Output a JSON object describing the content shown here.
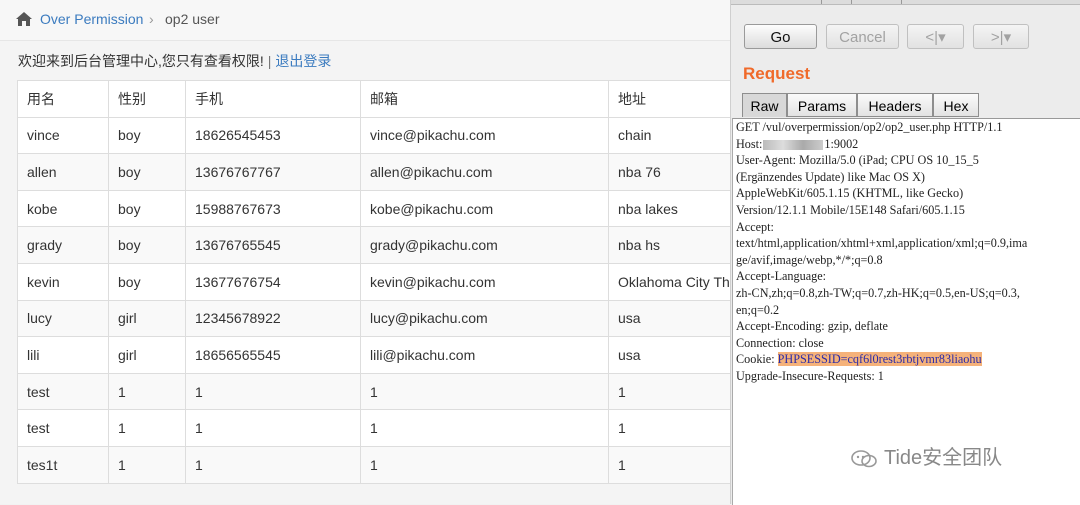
{
  "breadcrumb": {
    "root": "Over Permission",
    "current": "op2 user"
  },
  "welcome": {
    "text": "欢迎来到后台管理中心,您只有查看权限!",
    "separator": "|",
    "logout": "退出登录"
  },
  "table": {
    "headers": [
      "用名",
      "性别",
      "手机",
      "邮箱",
      "地址"
    ],
    "rows": [
      [
        "vince",
        "boy",
        "18626545453",
        "vince@pikachu.com",
        "chain"
      ],
      [
        "allen",
        "boy",
        "13676767767",
        "allen@pikachu.com",
        "nba 76"
      ],
      [
        "kobe",
        "boy",
        "15988767673",
        "kobe@pikachu.com",
        "nba lakes"
      ],
      [
        "grady",
        "boy",
        "13676765545",
        "grady@pikachu.com",
        "nba hs"
      ],
      [
        "kevin",
        "boy",
        "13677676754",
        "kevin@pikachu.com",
        "Oklahoma City Thunder"
      ],
      [
        "lucy",
        "girl",
        "12345678922",
        "lucy@pikachu.com",
        "usa"
      ],
      [
        "lili",
        "girl",
        "18656565545",
        "lili@pikachu.com",
        "usa"
      ],
      [
        "test",
        "1",
        "1",
        "1",
        "1"
      ],
      [
        "test",
        "1",
        "1",
        "1",
        "1"
      ],
      [
        "tes1t",
        "1",
        "1",
        "1",
        "1"
      ]
    ]
  },
  "burp": {
    "buttons": {
      "go": "Go",
      "cancel": "Cancel",
      "back": "<|▾",
      "forward": ">|▾"
    },
    "section_title": "Request",
    "tabs": [
      "Raw",
      "Params",
      "Headers",
      "Hex"
    ],
    "request_lines": [
      "GET /vul/overpermission/op2/op2_user.php HTTP/1.1",
      "Host:",
      "User-Agent: Mozilla/5.0 (iPad; CPU OS 10_15_5",
      "(Ergänzendes Update) like Mac OS X)",
      "AppleWebKit/605.1.15 (KHTML, like Gecko)",
      "Version/12.1.1 Mobile/15E148 Safari/605.1.15",
      "Accept:",
      "text/html,application/xhtml+xml,application/xml;q=0.9,ima",
      "ge/avif,image/webp,*/*;q=0.8",
      "Accept-Language:",
      "zh-CN,zh;q=0.8,zh-TW;q=0.7,zh-HK;q=0.5,en-US;q=0.3,",
      "en;q=0.2",
      "Accept-Encoding: gzip, deflate",
      "Connection: close",
      "Cookie: ",
      "Upgrade-Insecure-Requests: 1"
    ],
    "host_port": "1:9002",
    "cookie_value": "PHPSESSID=cqf6l0rest3rbtjvmr83liaohu",
    "highlight_color": "#f5b27a",
    "accent_color": "#f06a2a"
  },
  "watermark": "Tide安全团队",
  "colors": {
    "link": "#3b7bbf"
  }
}
